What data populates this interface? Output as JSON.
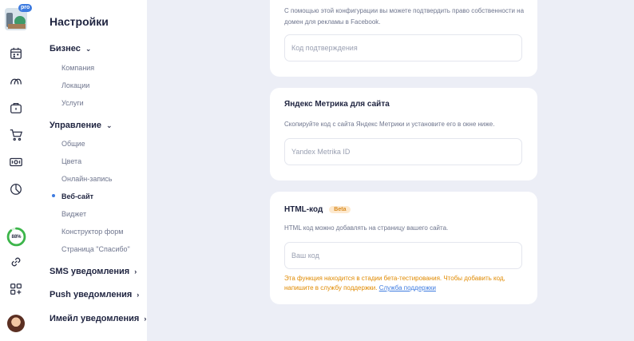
{
  "rail": {
    "pro_badge": "pro",
    "progress_label": "88%",
    "progress_value": 0.88,
    "icons": [
      "calendar-icon",
      "clients-icon",
      "briefcase-icon",
      "cart-icon",
      "cash-icon",
      "pie-chart-icon",
      "link-icon",
      "apps-add-icon"
    ]
  },
  "sidebar": {
    "title": "Настройки",
    "groups": [
      {
        "label": "Бизнес",
        "items": [
          "Компания",
          "Локации",
          "Услуги"
        ]
      },
      {
        "label": "Управление",
        "items": [
          "Общие",
          "Цвета",
          "Онлайн-запись",
          "Веб-сайт",
          "Виджет",
          "Конструктор форм",
          "Страница \"Спасибо\""
        ]
      },
      {
        "label": "SMS уведомления",
        "items": []
      },
      {
        "label": "Push уведомления",
        "items": []
      },
      {
        "label": "Имейл уведомления",
        "items": []
      }
    ],
    "active_item": "Веб-сайт"
  },
  "main": {
    "facebook": {
      "description": "С помощью этой конфигурации вы можете подтвердить право собственности на домен для рекламы в Facebook.",
      "placeholder": "Код подтверждения"
    },
    "yandex": {
      "title": "Яндекс Метрика для сайта",
      "description": "Скопируйте код с сайта Яндекс Метрики и установите его в окне ниже.",
      "placeholder": "Yandex Metrika ID"
    },
    "html": {
      "title": "HTML-код",
      "badge": "Beta",
      "description": "HTML код можно добавлять на страницу вашего сайта.",
      "placeholder": "Ваш код",
      "warning": "Эта функция находится в стадии бета-тестирования. Чтобы добавить код, напишите в службу поддержки.",
      "support_link": "Служба поддержки"
    }
  },
  "colors": {
    "accent": "#3d7be0",
    "progress": "#3cb54a",
    "warning": "#e08a00",
    "background": "#eceef6"
  }
}
